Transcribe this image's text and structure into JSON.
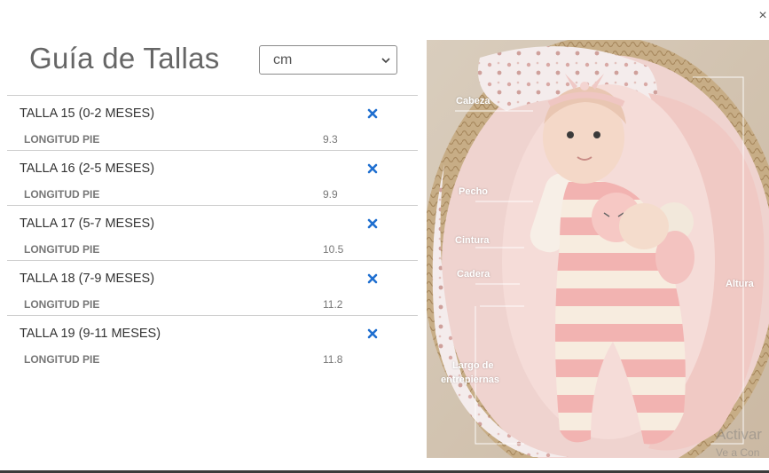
{
  "modal": {
    "close_label": "×",
    "title": "Guía de Tallas"
  },
  "unit_select": {
    "selected": "cm"
  },
  "sizes": [
    {
      "name": "TALLA 15 (0-2 MESES)",
      "measure_label": "LONGITUD PIE",
      "measure_value": "9.3"
    },
    {
      "name": "TALLA 16 (2-5 MESES)",
      "measure_label": "LONGITUD PIE",
      "measure_value": "9.9"
    },
    {
      "name": "TALLA 17 (5-7 MESES)",
      "measure_label": "LONGITUD PIE",
      "measure_value": "10.5"
    },
    {
      "name": "TALLA 18 (7-9 MESES)",
      "measure_label": "LONGITUD PIE",
      "measure_value": "11.2"
    },
    {
      "name": "TALLA 19 (9-11 MESES)",
      "measure_label": "LONGITUD PIE",
      "measure_value": "11.8"
    }
  ],
  "photo": {
    "labels": {
      "head": "Cabeza",
      "chest": "Pecho",
      "waist": "Cintura",
      "hip": "Cadera",
      "height": "Altura",
      "inseam_line1": "Largo de",
      "inseam_line2": "entrepiernas"
    }
  },
  "watermark": {
    "line1": "Activar",
    "line2": "Ve a Con"
  },
  "colors": {
    "accent_icon": "#1f6fd0",
    "divider": "#cfcfcf"
  },
  "icons": {
    "remove": "x-mark-icon",
    "select": "chevron-down-icon",
    "close": "close-icon"
  }
}
